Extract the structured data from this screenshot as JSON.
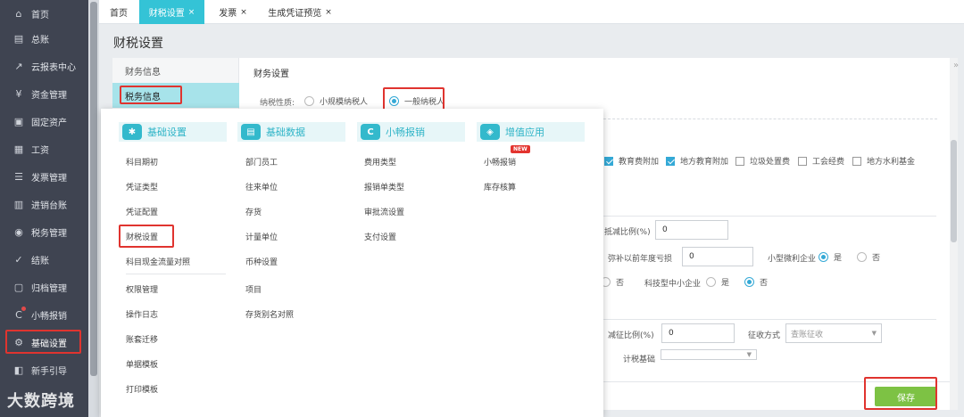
{
  "sidebar": {
    "items": [
      {
        "label": "首页",
        "icon": "home-icon",
        "glyph": "⌂"
      },
      {
        "label": "总账",
        "icon": "ledger-icon",
        "glyph": "▤"
      },
      {
        "label": "云报表中心",
        "icon": "report-chart-icon",
        "glyph": "↗"
      },
      {
        "label": "资金管理",
        "icon": "money-icon",
        "glyph": "¥"
      },
      {
        "label": "固定资产",
        "icon": "asset-icon",
        "glyph": "▣"
      },
      {
        "label": "工资",
        "icon": "salary-icon",
        "glyph": "▦"
      },
      {
        "label": "发票管理",
        "icon": "invoice-icon",
        "glyph": "☰"
      },
      {
        "label": "进销台账",
        "icon": "inventory-icon",
        "glyph": "▥"
      },
      {
        "label": "税务管理",
        "icon": "tax-icon",
        "glyph": "◉"
      },
      {
        "label": "结账",
        "icon": "checkout-icon",
        "glyph": "✓"
      },
      {
        "label": "归档管理",
        "icon": "archive-icon",
        "glyph": "▢"
      },
      {
        "label": "小畅报销",
        "icon": "reimburse-icon",
        "glyph": "C"
      },
      {
        "label": "基础设置",
        "icon": "settings-gear-icon",
        "glyph": "⚙"
      },
      {
        "label": "新手引导",
        "icon": "guide-icon",
        "glyph": "◧"
      }
    ]
  },
  "tabs": [
    {
      "label": "首页",
      "closable": false
    },
    {
      "label": "财税设置",
      "closable": true
    },
    {
      "label": "发票",
      "closable": true
    },
    {
      "label": "生成凭证预览",
      "closable": true
    }
  ],
  "tab_close_glyph": "×",
  "page_title": "财税设置",
  "left_nav": [
    "财务信息",
    "税务信息"
  ],
  "section_title": "财务设置",
  "taxpayer": {
    "label": "纳税性质:",
    "options": [
      "小规模纳税人",
      "一般纳税人"
    ]
  },
  "surcharges": [
    "教育费附加",
    "地方教育附加",
    "垃圾处置费",
    "工会经费",
    "地方水利基金"
  ],
  "form": {
    "reduce_ratio_label": "抵减比例(%)",
    "reduce_ratio_value": "0",
    "loss_label": "弥补以前年度亏损",
    "loss_value": "0",
    "small_label": "小型微利企业",
    "yes": "是",
    "no": "否",
    "tech_label": "科技型中小企业",
    "levy_ratio_label": "减征比例(%)",
    "levy_ratio_value": "0",
    "levy_method_label": "征收方式",
    "levy_method_placeholder": "查账征收",
    "calc_label": "计税基础"
  },
  "save_label": "保存",
  "mega_menu": {
    "categories": [
      {
        "title": "基础设置",
        "glyph": "✱",
        "items": [
          "科目期初",
          "凭证类型",
          "凭证配置",
          "财税设置",
          "科目现金流量对照",
          "权限管理",
          "操作日志",
          "账套迁移",
          "单据模板",
          "打印模板"
        ]
      },
      {
        "title": "基础数据",
        "glyph": "▤",
        "items": [
          "部门员工",
          "往来单位",
          "存货",
          "计量单位",
          "币种设置",
          "项目",
          "存货别名对照"
        ]
      },
      {
        "title": "小畅报销",
        "glyph": "C",
        "items": [
          "费用类型",
          "报销单类型",
          "审批流设置",
          "支付设置"
        ]
      },
      {
        "title": "增值应用",
        "glyph": "◈",
        "items": [
          "小畅报销",
          "库存核算"
        ]
      }
    ],
    "new_badge": "NEW"
  },
  "watermark": "大数跨境",
  "colors": {
    "accent": "#34c3d6",
    "highlight": "#e0342f",
    "save": "#7dc244",
    "sidebar": "#3f4451"
  }
}
